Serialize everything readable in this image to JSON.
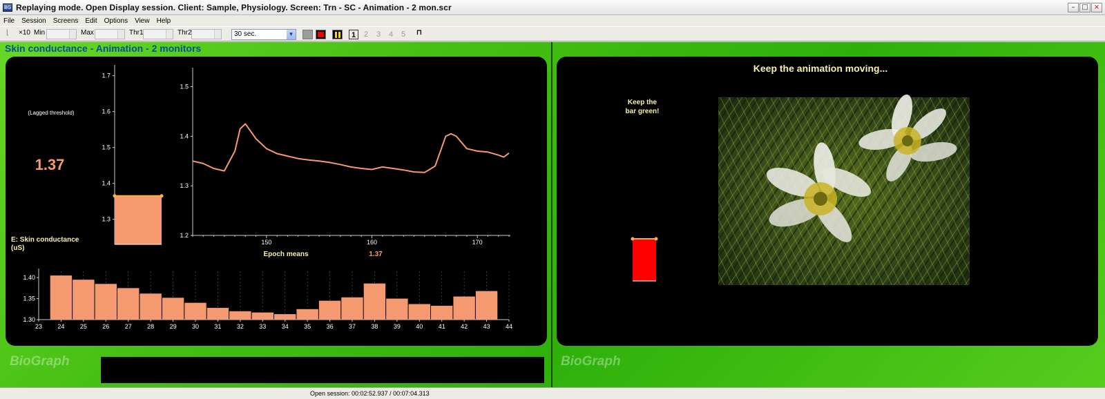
{
  "window": {
    "title": "Replaying mode. Open Display session. Client: Sample, Physiology. Screen: Trn - SC - Animation - 2 mon.scr",
    "icon_label": "BG"
  },
  "menu": [
    "File",
    "Session",
    "Screens",
    "Edit",
    "Options",
    "View",
    "Help"
  ],
  "toolbar": {
    "scale_label": "×10",
    "min_label": "Min",
    "max_label": "Max",
    "thr1_label": "Thr1",
    "thr2_label": "Thr2",
    "duration": "30 sec.",
    "pages": [
      "1",
      "2",
      "3",
      "4",
      "5"
    ],
    "active_page": "1"
  },
  "screen": {
    "title": "Skin conductance - Animation - 2 monitors",
    "watermark": "BioGraph"
  },
  "left": {
    "threshold_label": "(Lagged threshold)",
    "threshold_value": "1.37",
    "channel_label_line1": "E: Skin conductance",
    "channel_label_line2": "(uS)",
    "epoch_label": "Epoch means",
    "epoch_value": "1.37",
    "bar_gauge": {
      "value": 1.365,
      "ticks": [
        "1.7",
        "1.6",
        "1.5",
        "1.4",
        "1.3"
      ],
      "tick_values": [
        1.7,
        1.6,
        1.5,
        1.4,
        1.3
      ],
      "ylim": [
        1.23,
        1.73
      ]
    }
  },
  "right": {
    "header": "Keep the animation moving...",
    "instruction_line1": "Keep the",
    "instruction_line2": "bar green!"
  },
  "colors": {
    "trace": "#f59a70",
    "bar": "#f59a70",
    "gauge_red": "#ff0000",
    "cream_text": "#f7f0b0"
  },
  "chart_data": [
    {
      "type": "line",
      "x": [
        143,
        144,
        145,
        146,
        147,
        147.5,
        148,
        148.5,
        149,
        150,
        151,
        152,
        153,
        154,
        155,
        156,
        157,
        158,
        159,
        160,
        161,
        162,
        163,
        164,
        165,
        166,
        167,
        167.5,
        168,
        169,
        170,
        171,
        172,
        172.5,
        173
      ],
      "y": [
        1.35,
        1.345,
        1.335,
        1.33,
        1.37,
        1.415,
        1.425,
        1.41,
        1.395,
        1.375,
        1.365,
        1.36,
        1.355,
        1.352,
        1.35,
        1.347,
        1.343,
        1.338,
        1.335,
        1.333,
        1.338,
        1.335,
        1.332,
        1.328,
        1.327,
        1.34,
        1.4,
        1.405,
        1.4,
        1.375,
        1.37,
        1.368,
        1.362,
        1.358,
        1.366
      ],
      "xlim": [
        143,
        173
      ],
      "ylim": [
        1.2,
        1.53
      ],
      "xticks": [
        150,
        160,
        170
      ],
      "yticks": [
        1.2,
        1.3,
        1.4,
        1.5
      ],
      "xtick_labels": [
        "150",
        "160",
        "170"
      ],
      "ytick_labels": [
        "1.2",
        "1.3",
        "1.4",
        "1.5"
      ]
    },
    {
      "type": "bar",
      "categories": [
        "24",
        "25",
        "26",
        "27",
        "28",
        "29",
        "30",
        "31",
        "32",
        "33",
        "34",
        "35",
        "36",
        "37",
        "38",
        "39",
        "40",
        "41",
        "42",
        "43"
      ],
      "values": [
        1.405,
        1.395,
        1.385,
        1.375,
        1.362,
        1.352,
        1.34,
        1.328,
        1.32,
        1.317,
        1.313,
        1.325,
        1.345,
        1.353,
        1.386,
        1.35,
        1.337,
        1.333,
        1.355,
        1.368
      ],
      "xlim": [
        23,
        44
      ],
      "xticks": [
        "23",
        "24",
        "25",
        "26",
        "27",
        "28",
        "29",
        "30",
        "31",
        "32",
        "33",
        "34",
        "35",
        "36",
        "37",
        "38",
        "39",
        "40",
        "41",
        "42",
        "43",
        "44"
      ],
      "ylim": [
        1.3,
        1.415
      ],
      "yticks": [
        1.3,
        1.35,
        1.4
      ],
      "ytick_labels": [
        "1.30",
        "1.35",
        "1.40"
      ]
    }
  ],
  "statusbar": {
    "text": "Open session: 00:02:52.937 / 00:07:04.313"
  }
}
